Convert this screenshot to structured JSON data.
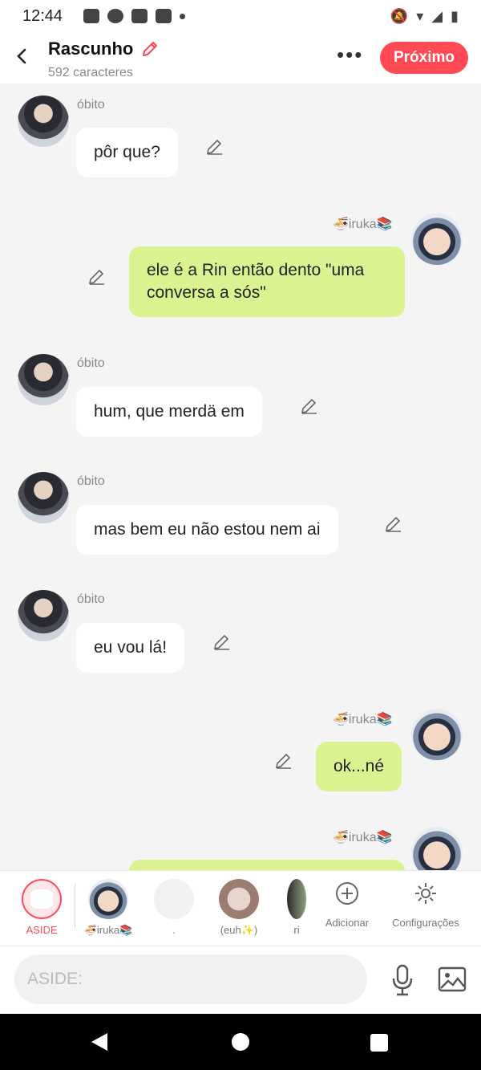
{
  "status": {
    "time": "12:44"
  },
  "header": {
    "title": "Rascunho",
    "subtitle": "592 caracteres",
    "next_label": "Próximo"
  },
  "messages": [
    {
      "sender": "óbito",
      "text": "pôr que?"
    },
    {
      "sender": "🍜iruka📚",
      "text": "ele é a Rin então dento \"uma conversa a sós\""
    },
    {
      "sender": "óbito",
      "text": "hum, que merdä em"
    },
    {
      "sender": "óbito",
      "text": "mas bem eu não estou nem ai"
    },
    {
      "sender": "óbito",
      "text": "eu vou lá!"
    },
    {
      "sender": "🍜iruka📚",
      "text": "ok...né"
    },
    {
      "sender": "🍜iruka📚",
      "text": ""
    }
  ],
  "characters": [
    {
      "label": "ASIDE"
    },
    {
      "label": "🍜iruka📚"
    },
    {
      "label": "."
    },
    {
      "label": "(euh✨)"
    },
    {
      "label": "ri"
    }
  ],
  "tools": {
    "add_label": "Adicionar",
    "settings_label": "Configurações"
  },
  "input": {
    "placeholder": "ASIDE:"
  },
  "colors": {
    "accent": "#ff4a55",
    "bubble_right": "#daf28f",
    "bubble_left": "#ffffff"
  }
}
